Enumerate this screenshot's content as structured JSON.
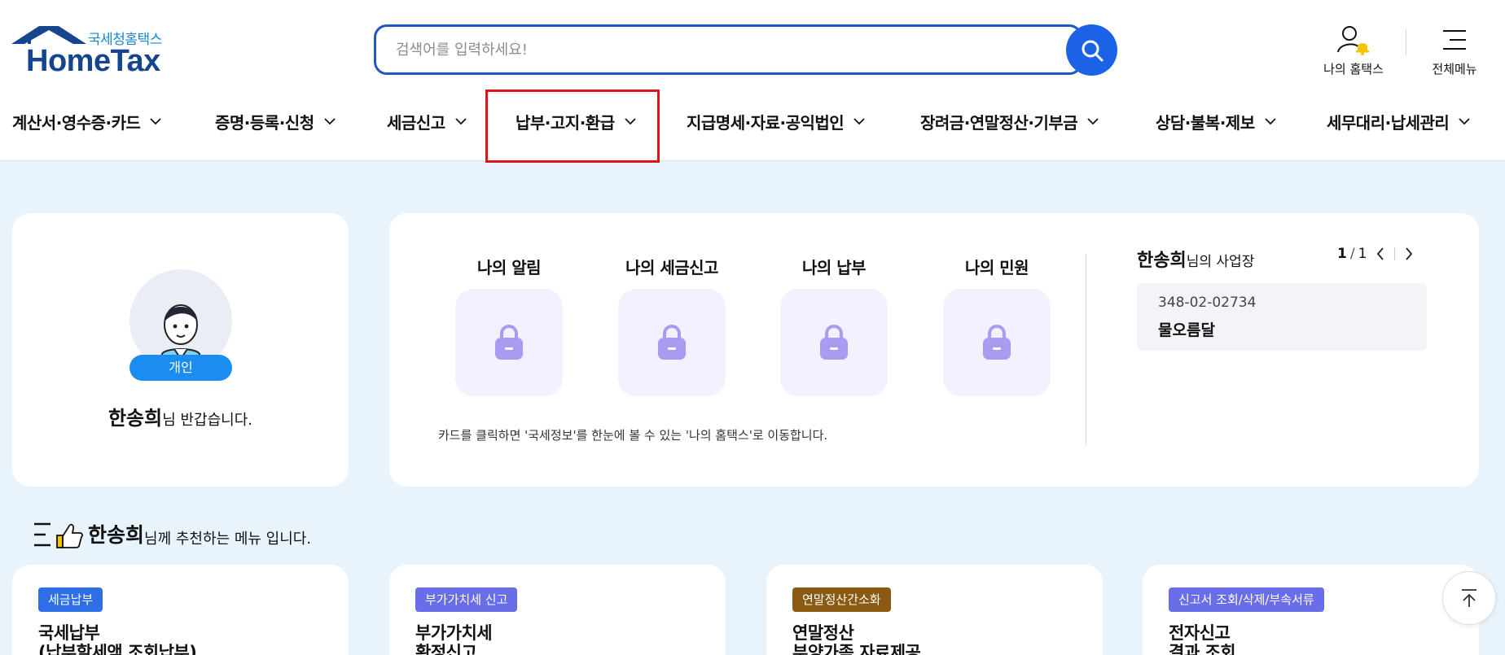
{
  "logo": {
    "sub": "국세청홈택스",
    "main": "HomeTax"
  },
  "search": {
    "placeholder": "검색어를 입력하세요!"
  },
  "header_utils": {
    "my_hometax": "나의 홈택스",
    "all_menu": "전체메뉴"
  },
  "nav": [
    {
      "label": "계산서·영수증·카드"
    },
    {
      "label": "증명·등록·신청"
    },
    {
      "label": "세금신고"
    },
    {
      "label": "납부·고지·환급",
      "highlighted": true
    },
    {
      "label": "지급명세·자료·공익법인"
    },
    {
      "label": "장려금·연말정산·기부금"
    },
    {
      "label": "상담·불복·제보"
    },
    {
      "label": "세무대리·납세관리"
    }
  ],
  "profile": {
    "badge": "개인",
    "name": "한송희",
    "greeting_suffix": "님 반갑습니다."
  },
  "my_section": {
    "boxes": [
      {
        "title": "나의 알림",
        "icon": "lock-icon"
      },
      {
        "title": "나의 세금신고",
        "icon": "lock-icon"
      },
      {
        "title": "나의 납부",
        "icon": "lock-icon"
      },
      {
        "title": "나의 민원",
        "icon": "lock-icon"
      }
    ],
    "hint": "카드를 클릭하면 '국세정보'를 한눈에 볼 수 있는 '나의 홈택스'로 이동합니다."
  },
  "business": {
    "owner": "한송희",
    "title_suffix": "님의 사업장",
    "page_current": "1",
    "page_total": "1",
    "number": "348-02-02734",
    "name": "물오름달"
  },
  "recommend": {
    "name": "한송희",
    "suffix": "님께 추천하는 메뉴 입니다.",
    "cards": [
      {
        "tag": "세금납부",
        "tag_color": "#2f6fe6",
        "line1": "국세납부",
        "line2": "(납부할세액 조회납부)"
      },
      {
        "tag": "부가가치세 신고",
        "tag_color": "#6a6de8",
        "line1": "부가가치세",
        "line2": "확정신고"
      },
      {
        "tag": "연말정산간소화",
        "tag_color": "#8a5a12",
        "line1": "연말정산",
        "line2": "부양가족 자료제공"
      },
      {
        "tag": "신고서 조회/삭제/부속서류",
        "tag_color": "#6a6de8",
        "line1": "전자신고",
        "line2": "결과 조회"
      }
    ]
  },
  "colors": {
    "primary": "#1b62e6",
    "nav_highlight": "#e0131a",
    "page_bg": "#e8f3fb",
    "lock_purple": "#a89cf0"
  }
}
